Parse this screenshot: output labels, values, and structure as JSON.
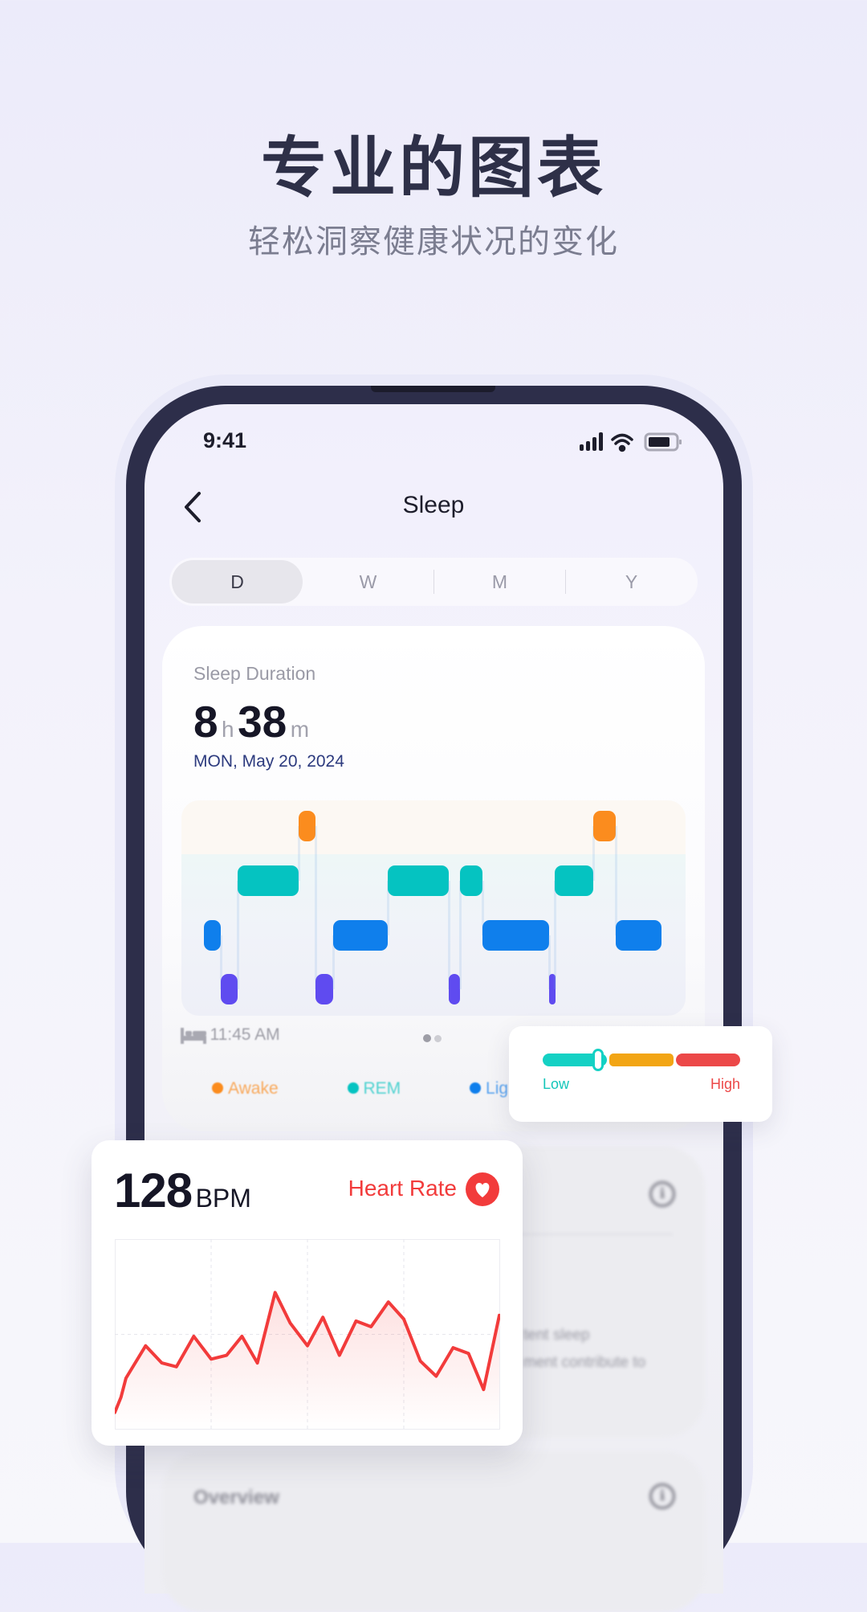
{
  "hero": {
    "title": "专业的图表",
    "subtitle": "轻松洞察健康状况的变化"
  },
  "status_bar": {
    "time": "9:41",
    "icons": [
      "signal-icon",
      "wifi-icon",
      "battery-icon"
    ]
  },
  "nav": {
    "title": "Sleep",
    "back_icon": "chevron-left-icon"
  },
  "segments": [
    {
      "label": "D",
      "selected": true
    },
    {
      "label": "W"
    },
    {
      "label": "M"
    },
    {
      "label": "Y"
    }
  ],
  "sleep_card": {
    "label": "Sleep Duration",
    "hours": "8",
    "hours_unit": "h",
    "minutes": "38",
    "minutes_unit": "m",
    "date": "MON, May 20, 2024",
    "bed_time": "11:45 AM",
    "page_dots": 2,
    "active_dot": 0,
    "legend": [
      {
        "label": "Awake",
        "color": "#fb8c1e"
      },
      {
        "label": "REM",
        "color": "#05c3c1"
      },
      {
        "label": "Lig",
        "color": "#0f7fec"
      }
    ]
  },
  "chart_data": [
    {
      "type": "timeline",
      "stages": [
        "awake",
        "rem",
        "light",
        "deep"
      ],
      "colors": {
        "awake": "#fb8c1e",
        "rem": "#05c3c1",
        "light": "#0f7fec",
        "deep": "#5f4bf0"
      },
      "segments_minutes": [
        {
          "stage": "light",
          "start": 0,
          "end": 19
        },
        {
          "stage": "deep",
          "start": 19,
          "end": 38
        },
        {
          "stage": "rem",
          "start": 38,
          "end": 107
        },
        {
          "stage": "awake",
          "start": 107,
          "end": 126
        },
        {
          "stage": "deep",
          "start": 126,
          "end": 146
        },
        {
          "stage": "light",
          "start": 146,
          "end": 208
        },
        {
          "stage": "rem",
          "start": 208,
          "end": 277
        },
        {
          "stage": "deep",
          "start": 277,
          "end": 290
        },
        {
          "stage": "rem",
          "start": 290,
          "end": 315
        },
        {
          "stage": "light",
          "start": 315,
          "end": 391
        },
        {
          "stage": "deep",
          "start": 391,
          "end": 397
        },
        {
          "stage": "rem",
          "start": 397,
          "end": 441
        },
        {
          "stage": "awake",
          "start": 441,
          "end": 466
        },
        {
          "stage": "light",
          "start": 466,
          "end": 518
        }
      ]
    },
    {
      "type": "line",
      "color": "#f23b3b",
      "grid": true,
      "xlim": [
        0,
        100
      ],
      "ylim": [
        0,
        100
      ],
      "x": [
        0,
        1.6,
        2.9,
        8,
        12.2,
        16,
        20.5,
        25,
        29,
        33,
        37,
        41.6,
        45.5,
        50,
        54,
        58.3,
        62.6,
        66.5,
        71,
        75,
        79.3,
        83.4,
        87.8,
        91.8,
        95.7,
        99.8
      ],
      "y": [
        9,
        17,
        27,
        44,
        35,
        33,
        49,
        37,
        39,
        49,
        35,
        72,
        56,
        44,
        59,
        39,
        57,
        54,
        67,
        58,
        36,
        28,
        43,
        40,
        21,
        60
      ]
    }
  ],
  "level_popup": {
    "low": "Low",
    "high": "High",
    "colors": [
      "#14d1c4",
      "#f2a514",
      "#ec4848"
    ],
    "level": 0.28
  },
  "heart_card": {
    "value": "128",
    "unit": "BPM",
    "label": "Heart Rate",
    "icon": "heart-icon",
    "accent": "#f23b3b"
  },
  "bg_card": {
    "line1": "tent sleep",
    "line2": "ment contribute to"
  },
  "overview": {
    "title": "Overview"
  }
}
